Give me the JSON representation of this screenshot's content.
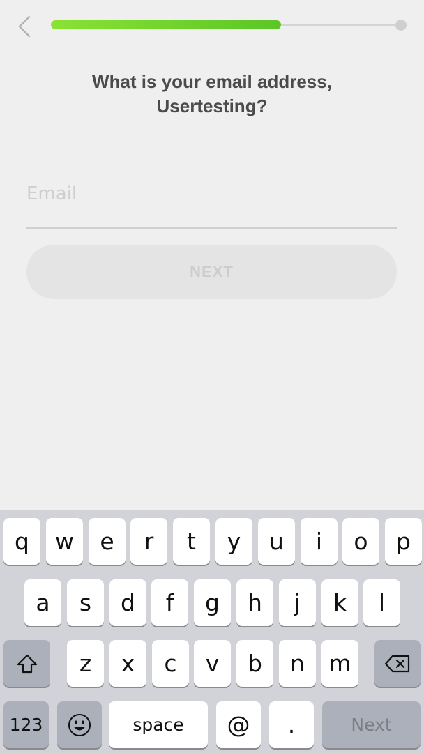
{
  "nav": {
    "back_icon": "chevron-left-icon"
  },
  "progress": {
    "fraction": 0.66,
    "fill_color_start": "#8ae234",
    "fill_color_end": "#5bc625",
    "track_color": "#d4d4d4"
  },
  "question": {
    "line1": "What is your email address,",
    "line2": "Usertesting?"
  },
  "email": {
    "value": "",
    "placeholder": "Email",
    "caret_color": "#6d7ef2"
  },
  "next_button": {
    "label": "NEXT",
    "enabled": false
  },
  "keyboard": {
    "row1": [
      "q",
      "w",
      "e",
      "r",
      "t",
      "y",
      "u",
      "i",
      "o",
      "p"
    ],
    "row2": [
      "a",
      "s",
      "d",
      "f",
      "g",
      "h",
      "j",
      "k",
      "l"
    ],
    "row3": [
      "z",
      "x",
      "c",
      "v",
      "b",
      "n",
      "m"
    ],
    "shift_icon": "shift-icon",
    "delete_icon": "backspace-icon",
    "numbers_label": "123",
    "emoji_icon": "emoji-icon",
    "space_label": "space",
    "at_label": "@",
    "dot_label": ".",
    "return_label": "Next"
  }
}
